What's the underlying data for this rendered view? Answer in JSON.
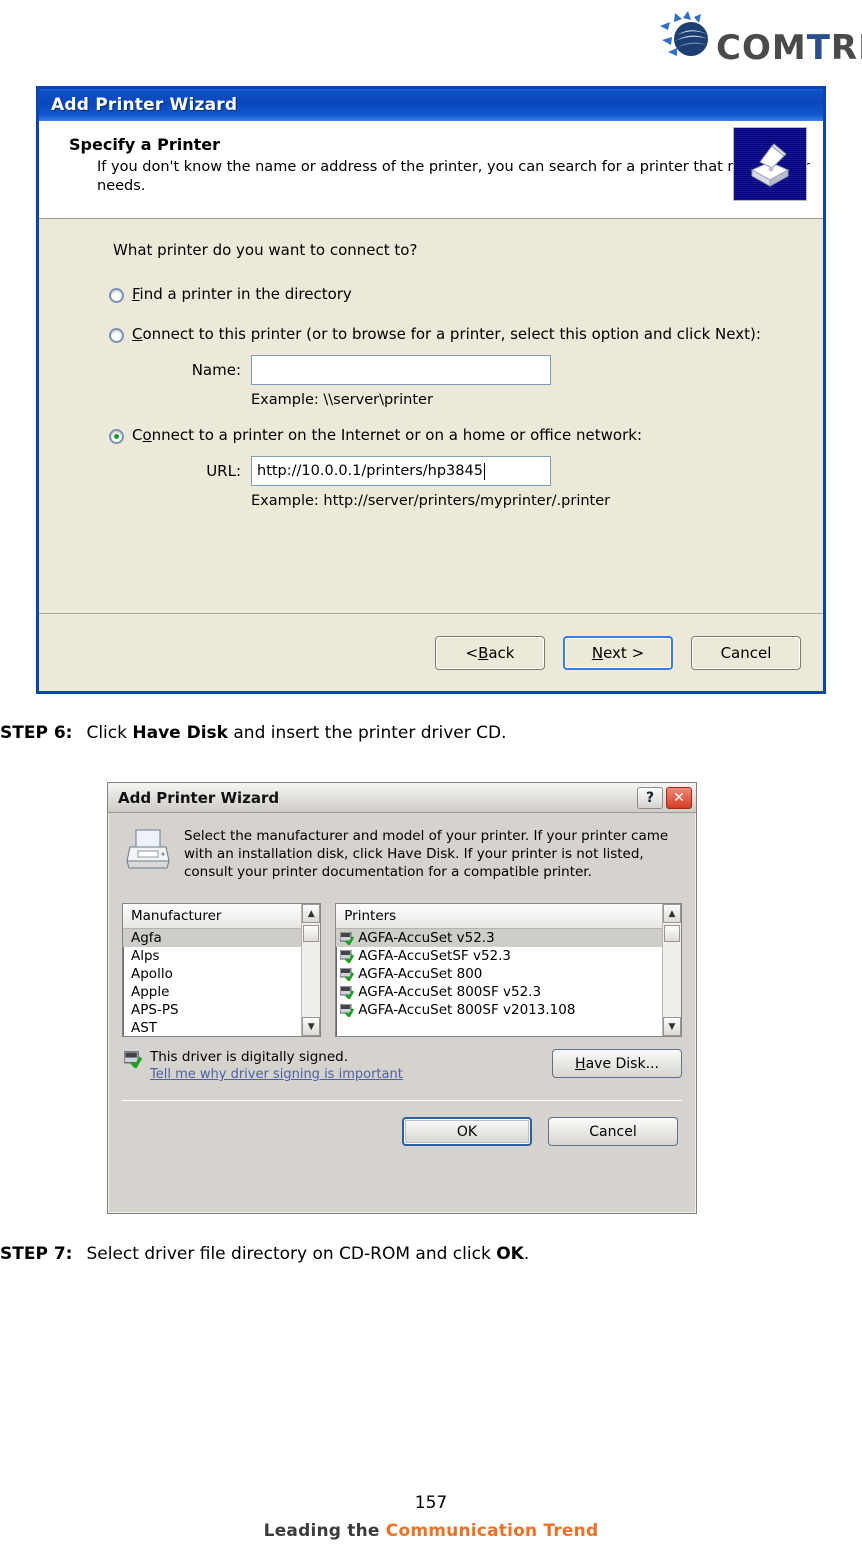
{
  "brand": {
    "name_part1": "COM",
    "name_part2": "T",
    "name_part3": "REND",
    "full": "COMTREND"
  },
  "dialog1": {
    "title": "Add Printer Wizard",
    "header_title": "Specify a Printer",
    "header_text": "If you don't know the name or address of the printer, you can search for a printer that meets your needs.",
    "question": "What printer do you want to connect to?",
    "options": [
      {
        "label_pre": "",
        "label_underline": "F",
        "label_post": "ind a printer in the directory",
        "selected": false
      },
      {
        "label_pre": "",
        "label_underline": "C",
        "label_post": "onnect to this printer (or to browse for a printer, select this option and click Next):",
        "selected": false
      },
      {
        "label_pre": "C",
        "label_underline": "o",
        "label_post": "nnect to a printer on the Internet or on a home or office network:",
        "selected": true
      }
    ],
    "name_label": "Name:",
    "name_value": "",
    "name_example": "Example: \\\\server\\printer",
    "url_label": "URL:",
    "url_value": "http://10.0.0.1/printers/hp3845",
    "url_example": "Example: http://server/printers/myprinter/.printer",
    "buttons": {
      "back": "< Back",
      "back_underline": "B",
      "back_pre": "< ",
      "back_post": "ack",
      "next_pre": "",
      "next_underline": "N",
      "next_post": "ext >",
      "cancel": "Cancel"
    },
    "icon": "printer-icon"
  },
  "step6": {
    "label": "STEP 6:",
    "text_pre": "Click ",
    "bold": "Have Disk",
    "text_post": " and insert the printer driver CD."
  },
  "dialog2": {
    "title": "Add Printer Wizard",
    "help_button": "?",
    "close_button": "✕",
    "description": "Select the manufacturer and model of your printer. If your printer came with an installation disk, click Have Disk. If your printer is not listed, consult your printer documentation for a compatible printer.",
    "manufacturer_header": "Manufacturer",
    "manufacturers": [
      {
        "name": "Agfa",
        "selected": true
      },
      {
        "name": "Alps",
        "selected": false
      },
      {
        "name": "Apollo",
        "selected": false
      },
      {
        "name": "Apple",
        "selected": false
      },
      {
        "name": "APS-PS",
        "selected": false
      },
      {
        "name": "AST",
        "selected": false
      }
    ],
    "printers_header": "Printers",
    "printers": [
      {
        "name": "AGFA-AccuSet v52.3",
        "selected": true
      },
      {
        "name": "AGFA-AccuSetSF v52.3",
        "selected": false
      },
      {
        "name": "AGFA-AccuSet 800",
        "selected": false
      },
      {
        "name": "AGFA-AccuSet 800SF v52.3",
        "selected": false
      },
      {
        "name": "AGFA-AccuSet 800SF v2013.108",
        "selected": false
      }
    ],
    "signed_text": "This driver is digitally signed.",
    "signed_link": "Tell me why driver signing is important",
    "have_disk_pre": "",
    "have_disk_underline": "H",
    "have_disk_post": "ave Disk...",
    "ok_button": "OK",
    "cancel_button": "Cancel",
    "scroll_up": "▲",
    "scroll_down": "▼"
  },
  "step7": {
    "label": "STEP 7:",
    "text_pre": "Select driver file directory on CD-ROM and click ",
    "bold": "OK",
    "text_post": "."
  },
  "footer": {
    "page_number": "157",
    "tagline_part1": "Leading the ",
    "tagline_part2": "Communication ",
    "tagline_part3": "Trend"
  },
  "colors": {
    "title_blue": "#0a43b5",
    "dialog_face": "#ece9d8",
    "brand_orange": "#ef7024",
    "link_blue": "#4b5fa8"
  }
}
